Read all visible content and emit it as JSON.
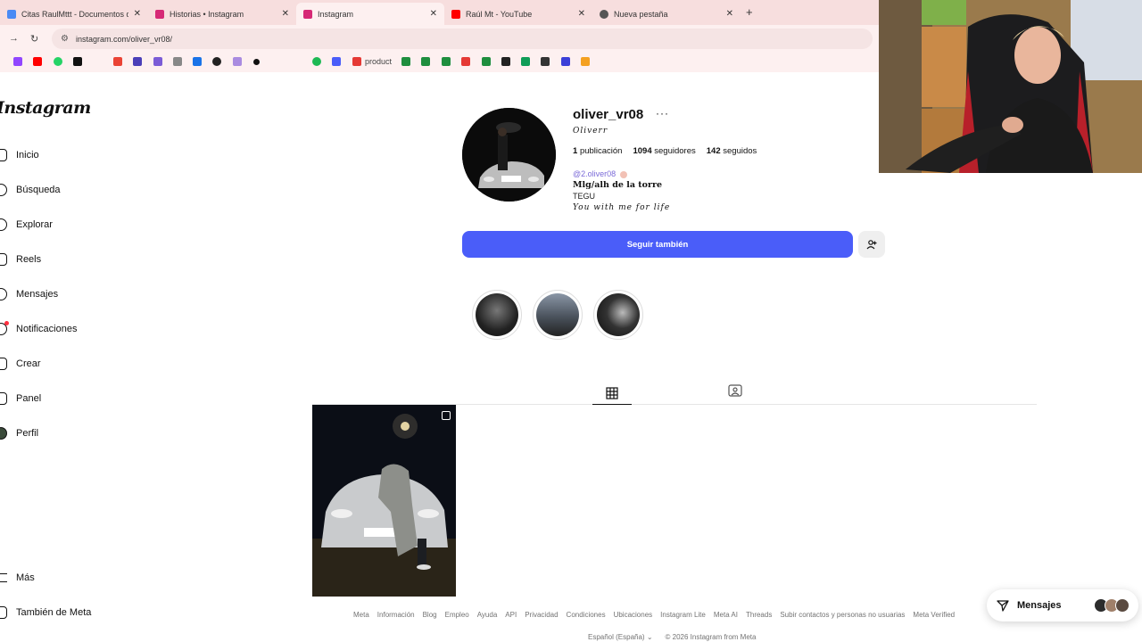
{
  "browser": {
    "tabs": [
      {
        "title": "Citas RaulMttt - Documentos de",
        "favicon_color": "#4a8af4",
        "active": false
      },
      {
        "title": "Historias • Instagram",
        "favicon_color": "#d62976",
        "active": false
      },
      {
        "title": "Instagram",
        "favicon_color": "#d62976",
        "active": true
      },
      {
        "title": "Raúl Mt - YouTube",
        "favicon_color": "#ff0000",
        "active": false
      },
      {
        "title": "Nueva pestaña",
        "favicon_color": "#555555",
        "active": false
      }
    ],
    "close_glyph": "✕",
    "new_tab_glyph": "+",
    "url": "instagram.com/oliver_vr08/",
    "bookmark_text": "product"
  },
  "sidebar": {
    "logo": "Instagram",
    "items": [
      {
        "label": "Inicio",
        "icon": "home-icon"
      },
      {
        "label": "Búsqueda",
        "icon": "search-icon"
      },
      {
        "label": "Explorar",
        "icon": "compass-icon"
      },
      {
        "label": "Reels",
        "icon": "reels-icon"
      },
      {
        "label": "Mensajes",
        "icon": "messenger-icon"
      },
      {
        "label": "Notificaciones",
        "icon": "heart-icon"
      },
      {
        "label": "Crear",
        "icon": "plus-icon"
      },
      {
        "label": "Panel",
        "icon": "dashboard-icon"
      },
      {
        "label": "Perfil",
        "icon": "avatar-icon"
      }
    ],
    "more": {
      "label": "Más",
      "icon": "menu-icon"
    },
    "meta": {
      "label": "También de Meta",
      "icon": "meta-icon"
    }
  },
  "profile": {
    "username": "oliver_vr08",
    "more_glyph": "···",
    "full_name": "Oliverr",
    "posts_count": "1",
    "posts_label": "publicación",
    "followers_count": "1094",
    "followers_label": "seguidores",
    "following_count": "142",
    "following_label": "seguidos",
    "threads_handle": "@2.oliver08",
    "bio_line1": "Mlg/alh de la torre",
    "bio_line2": "TEGU",
    "bio_line3": "You with me for life",
    "follow_button": "Seguir también",
    "suggest_icon": "add-person-icon"
  },
  "highlights": [
    {
      "color": "#2a2a2a"
    },
    {
      "color": "#5a6470"
    },
    {
      "color": "#1e1e1e"
    }
  ],
  "footer": {
    "links": [
      "Meta",
      "Información",
      "Blog",
      "Empleo",
      "Ayuda",
      "API",
      "Privacidad",
      "Condiciones",
      "Ubicaciones",
      "Instagram Lite",
      "Meta AI",
      "Threads",
      "Subir contactos y personas no usuarias",
      "Meta Verified"
    ],
    "language": "Español (España)",
    "copyright": "© 2026 Instagram from Meta"
  },
  "messages_pill": {
    "label": "Mensajes"
  },
  "colors": {
    "accent": "#4a5df9",
    "tabbar": "#f7dede"
  }
}
